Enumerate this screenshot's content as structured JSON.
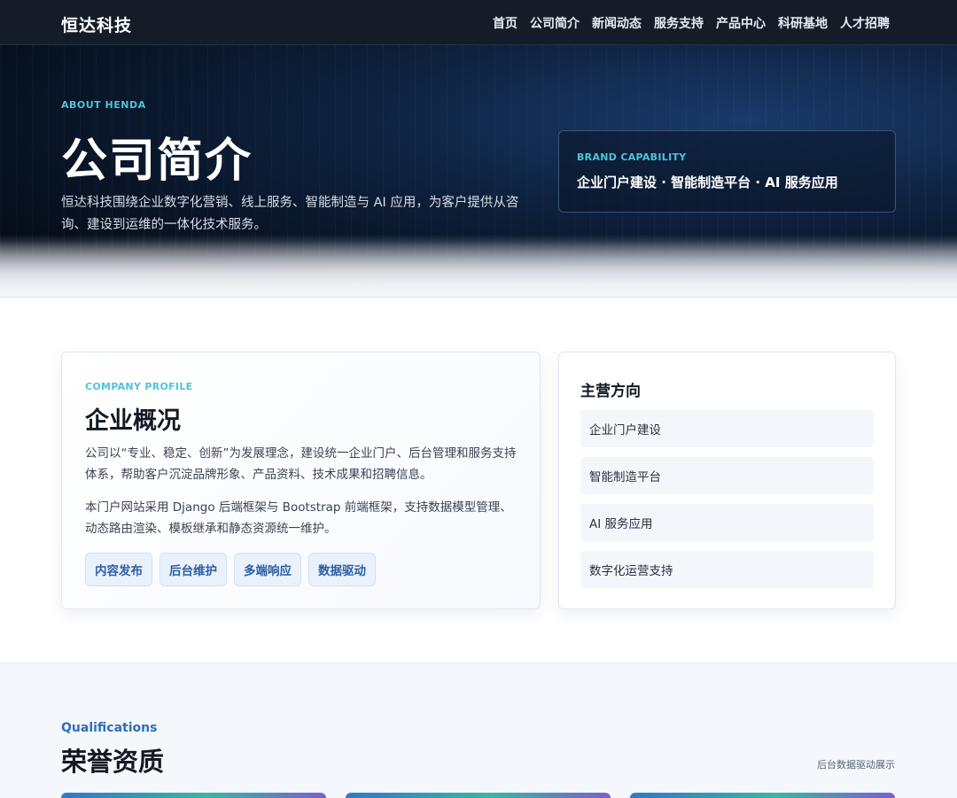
{
  "header": {
    "brand": "恒达科技",
    "nav": [
      "首页",
      "公司简介",
      "新闻动态",
      "服务支持",
      "产品中心",
      "科研基地",
      "人才招聘"
    ]
  },
  "hero": {
    "eyebrow": "ABOUT HENDA",
    "title": "公司简介",
    "description": "恒达科技围绕企业数字化营销、线上服务、智能制造与 AI 应用，为客户提供从咨询、建设到运维的一体化技术服务。",
    "card": {
      "eyebrow": "BRAND CAPABILITY",
      "text": "企业门户建设 · 智能制造平台 · AI 服务应用"
    }
  },
  "profile": {
    "eyebrow": "COMPANY PROFILE",
    "title": "企业概况",
    "paragraph1": "公司以“专业、稳定、创新”为发展理念，建设统一企业门户、后台管理和服务支持体系，帮助客户沉淀品牌形象、产品资料、技术成果和招聘信息。",
    "paragraph2": "本门户网站采用 Django 后端框架与 Bootstrap 前端框架，支持数据模型管理、动态路由渲染、模板继承和静态资源统一维护。",
    "tags": [
      "内容发布",
      "后台维护",
      "多端响应",
      "数据驱动"
    ]
  },
  "focus": {
    "title": "主营方向",
    "items": [
      "企业门户建设",
      "智能制造平台",
      "AI 服务应用",
      "数字化运营支持"
    ]
  },
  "qualifications": {
    "eyebrow": "Qualifications",
    "title": "荣誉资质",
    "note": "后台数据驱动展示"
  },
  "colors": {
    "header_bg": "#141c27",
    "hero_bg": "#0c1d36",
    "accent_cyan": "#4fc3d9",
    "accent_blue": "#2e6fb8",
    "tag_bg": "#eaf1fb"
  }
}
